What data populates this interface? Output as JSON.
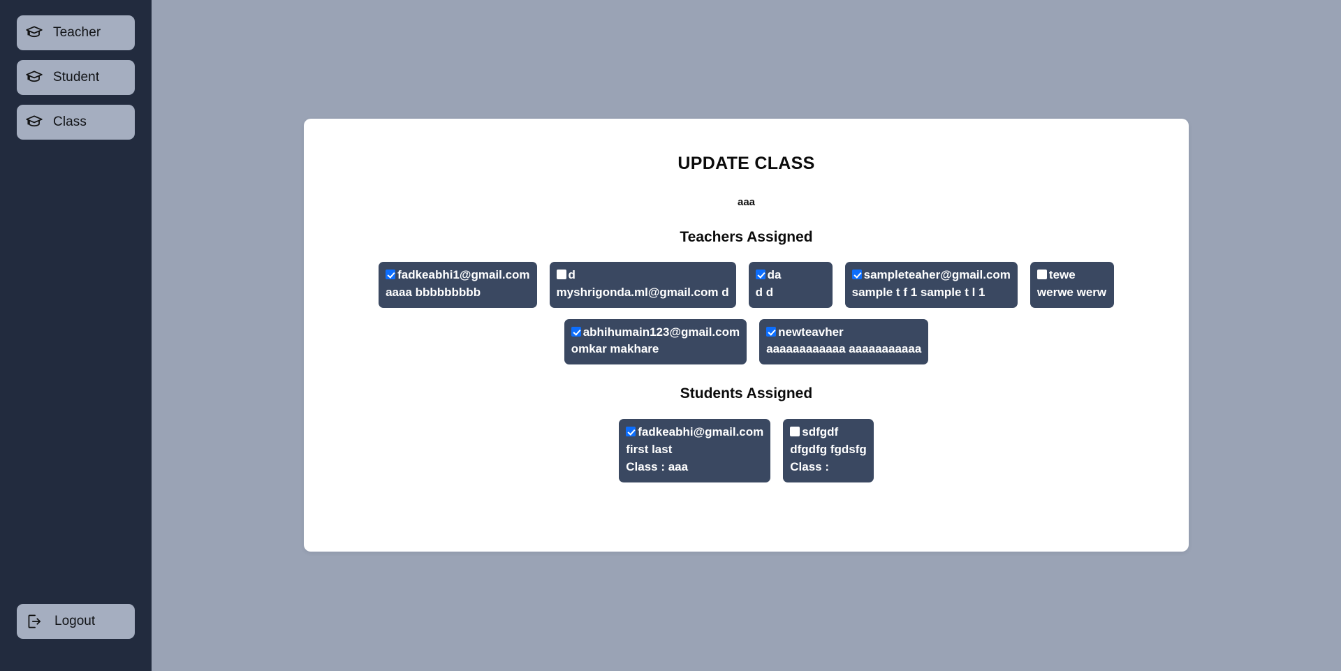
{
  "sidebar": {
    "nav_items": [
      {
        "label": "Teacher",
        "icon": "graduation-cap-icon"
      },
      {
        "label": "Student",
        "icon": "graduation-cap-icon"
      },
      {
        "label": "Class",
        "icon": "graduation-cap-icon"
      }
    ],
    "logout": {
      "label": "Logout",
      "icon": "logout-icon"
    }
  },
  "panel": {
    "title": "UPDATE CLASS",
    "subtitle": "aaa",
    "teachers_section_title": "Teachers Assigned",
    "students_section_title": "Students Assigned",
    "teachers": [
      {
        "email": "fadkeabhi1@gmail.com",
        "name": "aaaa bbbbbbbbb",
        "checked": true
      },
      {
        "email": "d",
        "name": "myshrigonda.ml@gmail.com d",
        "checked": false
      },
      {
        "email": "da",
        "name": "d d",
        "checked": true
      },
      {
        "email": "sampleteaher@gmail.com",
        "name": "sample t f 1 sample t l 1",
        "checked": true
      },
      {
        "email": "tewe",
        "name": "werwe werw",
        "checked": false
      },
      {
        "email": "abhihumain123@gmail.com",
        "name": "omkar makhare",
        "checked": true
      },
      {
        "email": "newteavher",
        "name": "aaaaaaaaaaaa aaaaaaaaaaa",
        "checked": true
      }
    ],
    "students": [
      {
        "email": "fadkeabhi@gmail.com",
        "name": "first last",
        "class": "Class : aaa",
        "checked": true
      },
      {
        "email": "sdfgdf",
        "name": "dfgdfg fgdsfg",
        "class": "Class :",
        "checked": false
      }
    ]
  },
  "colors": {
    "sidebar_bg": "#222b3e",
    "page_bg": "#9aa3b5",
    "panel_bg": "#ffffff",
    "card_bg": "#3a4861",
    "nav_button_bg": "#a5aec0",
    "checkbox_accent": "#0d6efd"
  }
}
